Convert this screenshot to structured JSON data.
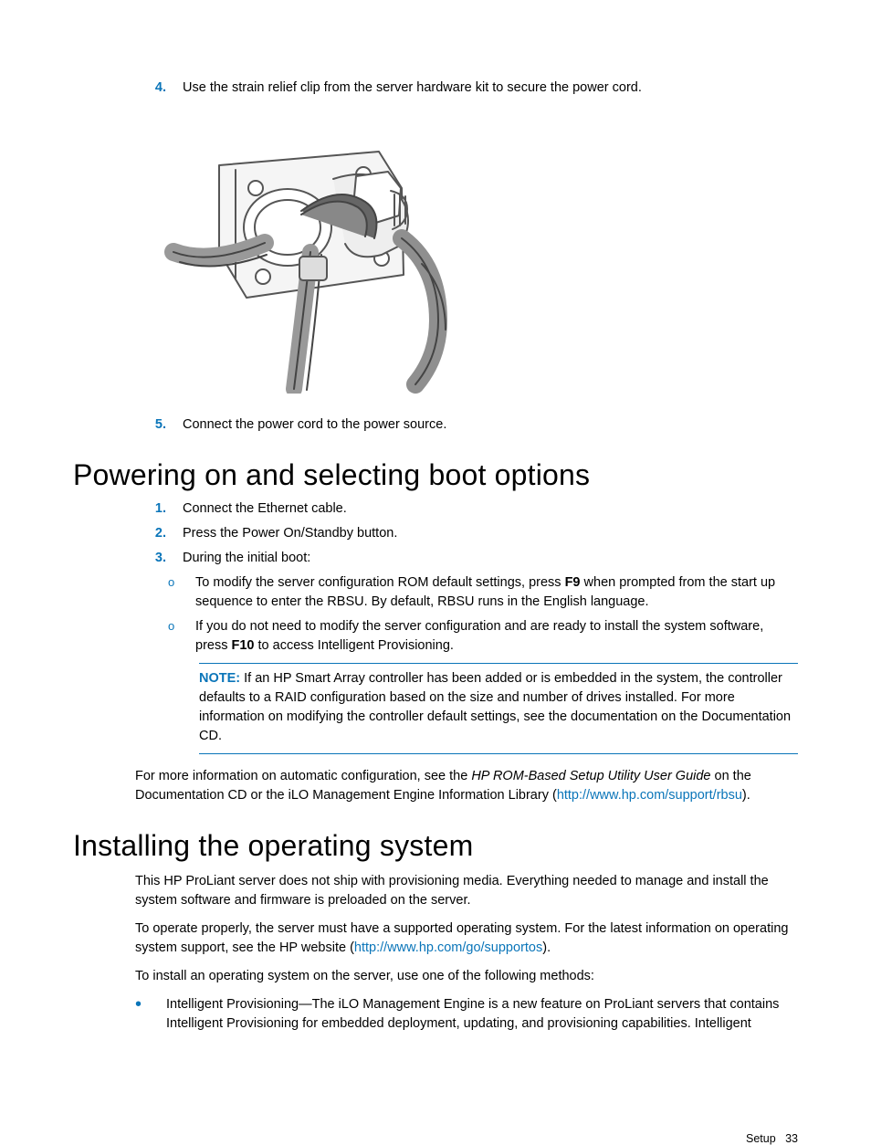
{
  "steps_top": [
    {
      "num": "4.",
      "text": "Use the strain relief clip from the server hardware kit to secure the power cord."
    },
    {
      "num": "5.",
      "text": "Connect the power cord to the power source."
    }
  ],
  "heading1": "Powering on and selecting boot options",
  "boot_steps": [
    {
      "num": "1.",
      "text": "Connect the Ethernet cable."
    },
    {
      "num": "2.",
      "text": "Press the Power On/Standby button."
    },
    {
      "num": "3.",
      "text": "During the initial boot:"
    }
  ],
  "sub_o1_pre": "To modify the server configuration ROM default settings, press ",
  "sub_o1_bold": "F9",
  "sub_o1_post": " when prompted from the start up sequence to enter the RBSU. By default, RBSU runs in the English language.",
  "sub_o2_pre": "If you do not need to modify the server configuration and are ready to install the system software, press ",
  "sub_o2_bold": "F10",
  "sub_o2_post": " to access Intelligent Provisioning.",
  "sub_marker": "o",
  "note_label": "NOTE:",
  "note_text": "  If an HP Smart Array controller has been added or is embedded in the system, the controller defaults to a RAID configuration based on the size and number of drives installed. For more information on modifying the controller default settings, see the documentation on the Documentation CD.",
  "moreinfo_pre": "For more information on automatic configuration, see the ",
  "moreinfo_italic": "HP ROM-Based Setup Utility User Guide",
  "moreinfo_mid": " on the Documentation CD or the iLO Management Engine Information Library (",
  "moreinfo_link": "http://www.hp.com/support/rbsu",
  "moreinfo_post": ").",
  "heading2": "Installing the operating system",
  "os_para1": "This HP ProLiant server does not ship with provisioning media. Everything needed to manage and install the system software and firmware is preloaded on the server.",
  "os_para2_pre": "To operate properly, the server must have a supported operating system. For the latest information on operating system support, see the HP website (",
  "os_para2_link": "http://www.hp.com/go/supportos",
  "os_para2_post": ").",
  "os_para3": "To install an operating system on the server, use one of the following methods:",
  "bullet1": "Intelligent Provisioning—The iLO Management Engine is a new feature on ProLiant servers that contains Intelligent Provisioning for embedded deployment, updating, and provisioning capabilities. Intelligent",
  "footer_section": "Setup",
  "footer_page": "33"
}
